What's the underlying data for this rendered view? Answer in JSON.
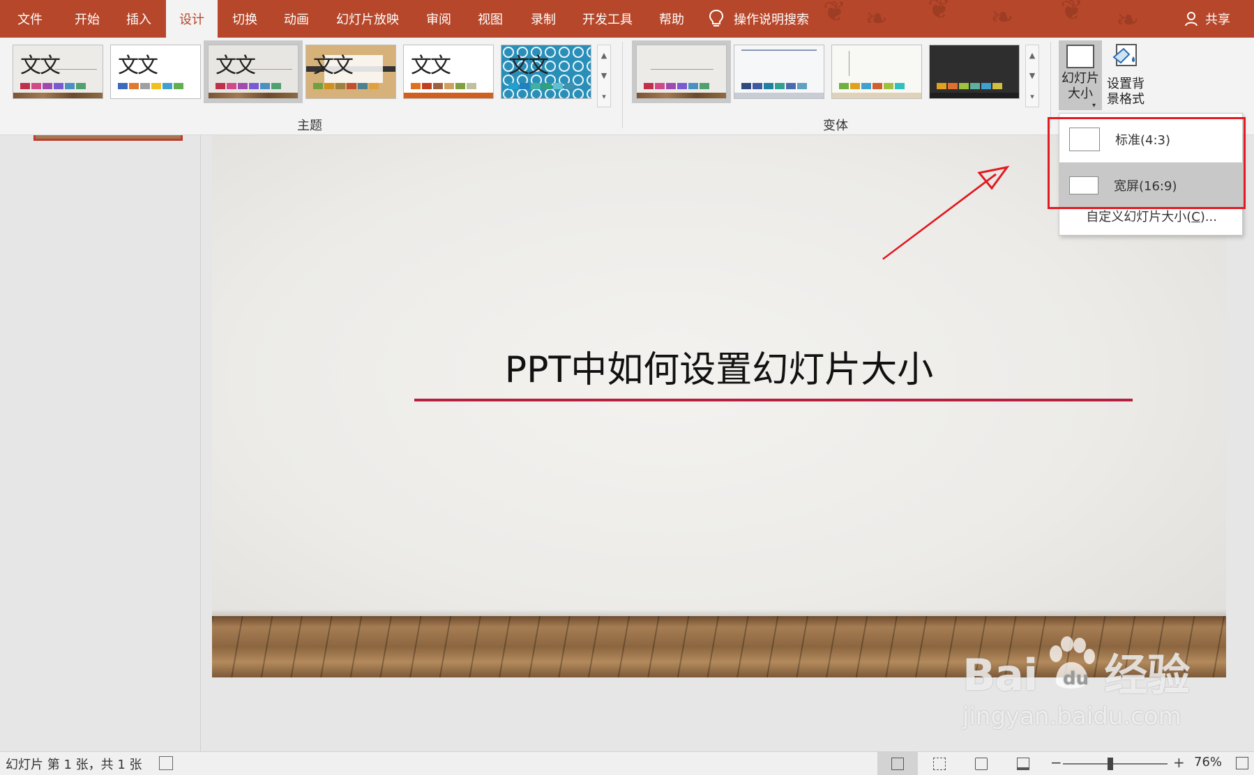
{
  "menu": {
    "tabs": [
      {
        "label": "文件"
      },
      {
        "label": "开始"
      },
      {
        "label": "插入"
      },
      {
        "label": "设计"
      },
      {
        "label": "切换"
      },
      {
        "label": "动画"
      },
      {
        "label": "幻灯片放映"
      },
      {
        "label": "审阅"
      },
      {
        "label": "视图"
      },
      {
        "label": "录制"
      },
      {
        "label": "开发工具"
      },
      {
        "label": "帮助"
      }
    ],
    "active_tab": "设计",
    "tell_me": "操作说明搜索",
    "share": "共享"
  },
  "ribbon": {
    "themes_group_label": "主题",
    "variants_group_label": "变体",
    "theme_sample_text": "文文",
    "themes": [
      {
        "swatches": [
          "#c0304a",
          "#d04a8a",
          "#a04ab0",
          "#7a5ad0",
          "#4a90c0",
          "#50a070"
        ],
        "bg": "#ecebe8"
      },
      {
        "swatches": [
          "#3a6ac0",
          "#e07a30",
          "#a0a0a0",
          "#f0c020",
          "#40a0d0",
          "#60b050"
        ],
        "bg": "#ffffff"
      },
      {
        "swatches": [
          "#c0304a",
          "#d04a8a",
          "#a04ab0",
          "#7a5ad0",
          "#4a90c0",
          "#50a070"
        ],
        "bg": "#e8e6e2"
      },
      {
        "swatches": [
          "#70a040",
          "#d09020",
          "#a08040",
          "#c05030",
          "#508090",
          "#e0a040"
        ],
        "bg": "#d6b27a"
      },
      {
        "swatches": [
          "#e07020",
          "#c04020",
          "#a06040",
          "#d0a060",
          "#80a040",
          "#c0c0a0"
        ],
        "bg": "#ffffff"
      },
      {
        "swatches": [
          "#20a0d0",
          "#2080c0",
          "#40b0a0",
          "#30a080",
          "#60c0d0",
          "#4090b0"
        ],
        "bg": "#2a8fb8"
      }
    ],
    "variants": [
      {
        "swatches": [
          "#c0304a",
          "#d04a8a",
          "#a04ab0",
          "#7a5ad0",
          "#4a90c0",
          "#50a070"
        ],
        "bg": "#ecebe8"
      },
      {
        "swatches": [
          "#304a80",
          "#405aa0",
          "#2080a0",
          "#30a090",
          "#4a6ab0",
          "#60a0c0"
        ],
        "bg": "#f6f7f9"
      },
      {
        "swatches": [
          "#70b040",
          "#e0a020",
          "#40a0d0",
          "#d06030",
          "#a0c040",
          "#30c0c0"
        ],
        "bg": "#f8f8f4"
      },
      {
        "swatches": [
          "#e0a020",
          "#e07030",
          "#a0c040",
          "#60b0a0",
          "#40a0d0",
          "#d0c040"
        ],
        "bg": "#2e2e2e"
      }
    ],
    "slide_size_button": "幻灯片\n大小",
    "format_background_button": "设置背\n景格式"
  },
  "dropdown": {
    "items": [
      {
        "label": "标准(4:3)"
      },
      {
        "label": "宽屏(16:9)"
      }
    ],
    "custom_prefix": "自定义幻灯片大小(",
    "custom_key": "C",
    "custom_suffix": ")..."
  },
  "slide": {
    "title": "PPT中如何设置幻灯片大小"
  },
  "status": {
    "slide_info": "幻灯片 第 1 张，共 1 张",
    "zoom_minus": "−",
    "zoom_plus": "+",
    "zoom_level": "76%",
    "zoom_fraction": 0.45
  },
  "watermark": {
    "brand_left": "Bai",
    "brand_right": "经验",
    "url": "jingyan.baidu.com"
  },
  "colors": {
    "accent": "#b7472a",
    "highlight": "#e21a22",
    "title_rule": "#b5203e"
  },
  "icons": {
    "tell_me": "lightbulb-icon",
    "share": "person-icon",
    "slide_size": "slide-size-icon",
    "format_background": "format-background-icon"
  }
}
